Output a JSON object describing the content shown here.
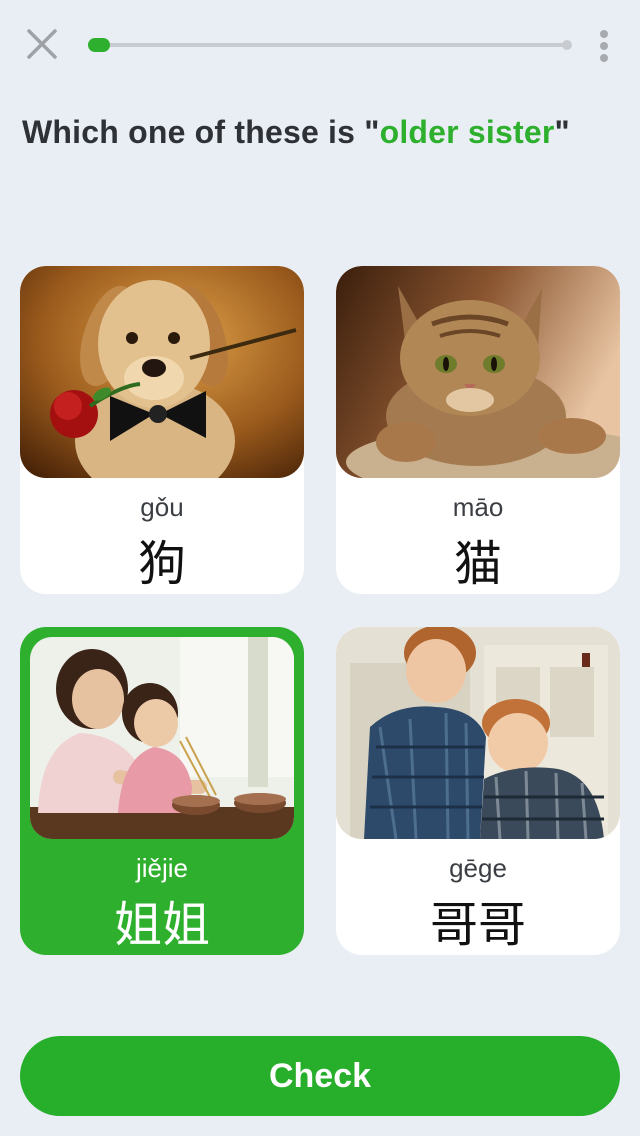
{
  "header": {
    "close_icon": "close-icon",
    "more_icon": "vertical-dots-icon",
    "progress": 0.03,
    "accent_color": "#2eb02e"
  },
  "question": {
    "prefix": "Which one of these is \"",
    "highlight": "older sister",
    "suffix": "\""
  },
  "choices": [
    {
      "pinyin": "gǒu",
      "hanzi": "狗",
      "image": "puppy with rose and bow tie",
      "selected": false
    },
    {
      "pinyin": "māo",
      "hanzi": "猫",
      "image": "tabby kitten",
      "selected": false
    },
    {
      "pinyin": "jiějie",
      "hanzi": "姐姐",
      "image": "older sister helping little girl with chopsticks",
      "selected": true
    },
    {
      "pinyin": "gēge",
      "hanzi": "哥哥",
      "image": "two young brothers in plaid shirts",
      "selected": false
    }
  ],
  "footer": {
    "check_label": "Check"
  }
}
